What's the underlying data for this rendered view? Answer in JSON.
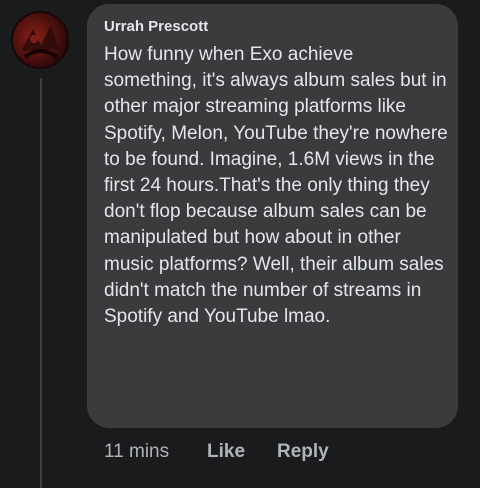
{
  "comment": {
    "author": "Urrah Prescott",
    "text": "How funny when Exo achieve something, it's always album sales but in other major streaming platforms like Spotify, Melon, YouTube they're nowhere to be found. Imagine, 1.6M views in the first 24 hours.That's the only thing they don't flop because album sales can be manipulated but how about in other music platforms? Well, their album sales didn't match the number of streams in Spotify and YouTube lmao.",
    "time": "11 mins",
    "like_label": "Like",
    "reply_label": "Reply"
  }
}
